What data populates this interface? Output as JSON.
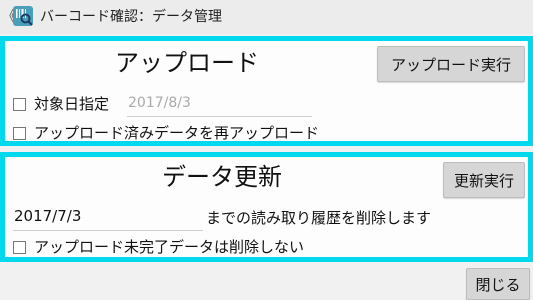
{
  "app": {
    "title": "バーコード確認：データ管理",
    "back_glyph": "《"
  },
  "upload": {
    "title": "アップロード",
    "run_button": "アップロード実行",
    "date_filter_label": "対象日指定",
    "date_value": "2017/8/3",
    "reupload_label": "アップロード済みデータを再アップロード"
  },
  "update": {
    "title": "データ更新",
    "run_button": "更新実行",
    "date_value": "2017/7/3",
    "delete_suffix": "までの読み取り履歴を削除します",
    "keep_incomplete_label": "アップロード未完了データは削除しない"
  },
  "footer": {
    "close_button": "閉じる"
  },
  "colors": {
    "accent_border": "#00d8ee",
    "button_bg": "#d6d6d6"
  },
  "icons": {
    "app_icon": "barcode-search-icon"
  }
}
